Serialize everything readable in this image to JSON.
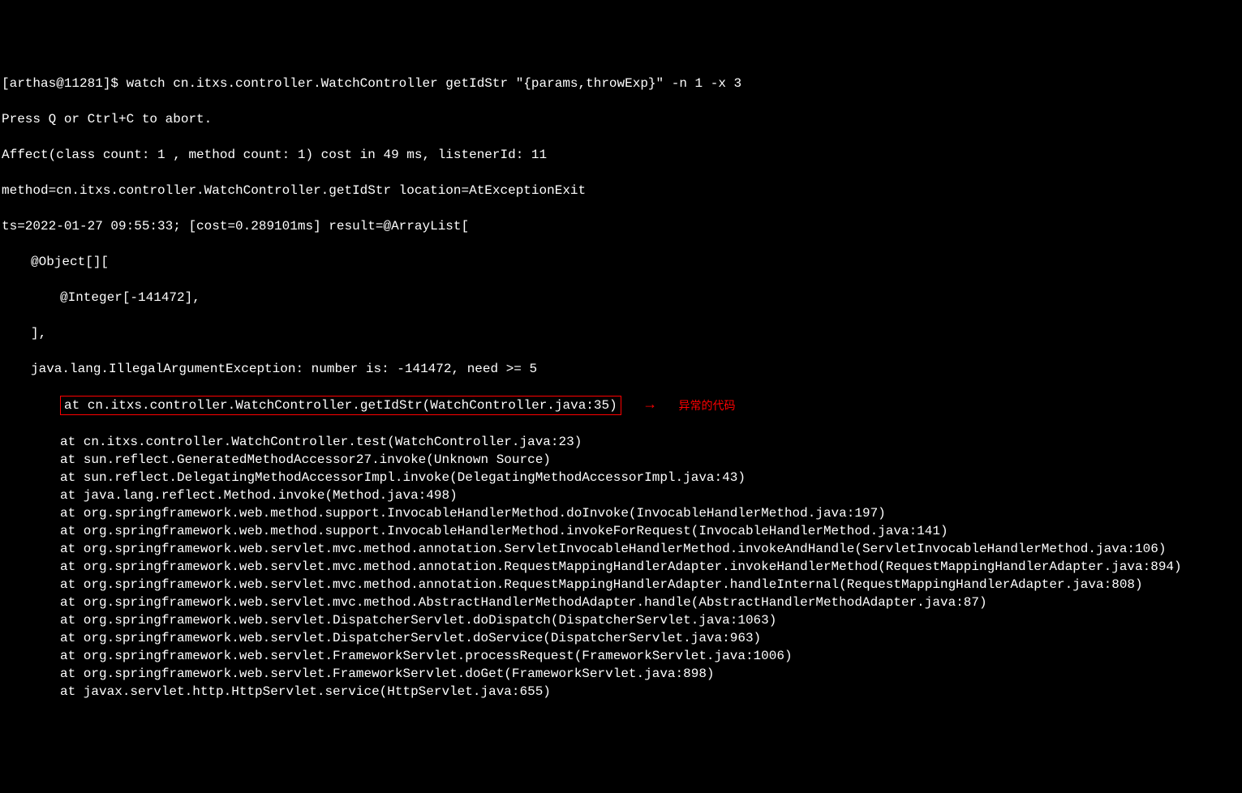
{
  "prompt": "[arthas@11281]$ ",
  "command": "watch cn.itxs.controller.WatchController getIdStr \"{params,throwExp}\" -n 1 -x 3",
  "abort_hint": "Press Q or Ctrl+C to abort.",
  "affect_line": "Affect(class count: 1 , method count: 1) cost in 49 ms, listenerId: 11",
  "method_line": "method=cn.itxs.controller.WatchController.getIdStr location=AtExceptionExit",
  "ts_line": "ts=2022-01-27 09:55:33; [cost=0.289101ms] result=@ArrayList[",
  "result": {
    "object_open": "@Object[][",
    "integer_val": "@Integer[-141472],",
    "object_close": "],",
    "exception_msg": "java.lang.IllegalArgumentException: number is: -141472, need >= 5"
  },
  "highlighted_frame": "at cn.itxs.controller.WatchController.getIdStr(WatchController.java:35)",
  "annotation": {
    "arrow": "→",
    "text": "异常的代码"
  },
  "stack_frames": [
    "at cn.itxs.controller.WatchController.test(WatchController.java:23)",
    "at sun.reflect.GeneratedMethodAccessor27.invoke(Unknown Source)",
    "at sun.reflect.DelegatingMethodAccessorImpl.invoke(DelegatingMethodAccessorImpl.java:43)",
    "at java.lang.reflect.Method.invoke(Method.java:498)",
    "at org.springframework.web.method.support.InvocableHandlerMethod.doInvoke(InvocableHandlerMethod.java:197)",
    "at org.springframework.web.method.support.InvocableHandlerMethod.invokeForRequest(InvocableHandlerMethod.java:141)",
    "at org.springframework.web.servlet.mvc.method.annotation.ServletInvocableHandlerMethod.invokeAndHandle(ServletInvocableHandlerMethod.java:106)",
    "at org.springframework.web.servlet.mvc.method.annotation.RequestMappingHandlerAdapter.invokeHandlerMethod(RequestMappingHandlerAdapter.java:894)",
    "at org.springframework.web.servlet.mvc.method.annotation.RequestMappingHandlerAdapter.handleInternal(RequestMappingHandlerAdapter.java:808)",
    "at org.springframework.web.servlet.mvc.method.AbstractHandlerMethodAdapter.handle(AbstractHandlerMethodAdapter.java:87)",
    "at org.springframework.web.servlet.DispatcherServlet.doDispatch(DispatcherServlet.java:1063)",
    "at org.springframework.web.servlet.DispatcherServlet.doService(DispatcherServlet.java:963)",
    "at org.springframework.web.servlet.FrameworkServlet.processRequest(FrameworkServlet.java:1006)",
    "at org.springframework.web.servlet.FrameworkServlet.doGet(FrameworkServlet.java:898)",
    "at javax.servlet.http.HttpServlet.service(HttpServlet.java:655)"
  ]
}
